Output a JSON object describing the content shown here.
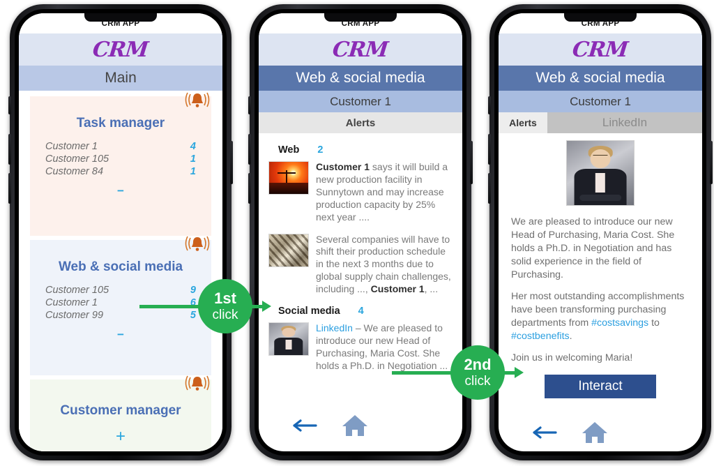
{
  "colors": {
    "brand_purple": "#8b2bb5",
    "accent_blue": "#2ba6de",
    "nav_dark": "#5976ab",
    "nav_light": "#b9c8e6",
    "callout_green": "#27ae52",
    "interact_blue": "#2d4f8e"
  },
  "phone1": {
    "status_title": "CRM APP",
    "brand": "CRM",
    "nav_title": "Main",
    "cards": [
      {
        "title": "Task manager",
        "rows": [
          {
            "name": "Customer 1",
            "value": "4"
          },
          {
            "name": "Customer 105",
            "value": "1"
          },
          {
            "name": "Customer 84",
            "value": "1"
          }
        ],
        "more": "−"
      },
      {
        "title": "Web & social media",
        "rows": [
          {
            "name": "Customer 105",
            "value": "9"
          },
          {
            "name": "Customer 1",
            "value": "6"
          },
          {
            "name": "Customer 99",
            "value": "5"
          }
        ],
        "more": "−"
      },
      {
        "title": "Customer manager",
        "rows": [],
        "more": "+"
      }
    ]
  },
  "phone2": {
    "status_title": "CRM APP",
    "brand": "CRM",
    "nav_title": "Web & social media",
    "sub_title": "Customer 1",
    "section_title": "Alerts",
    "groups": [
      {
        "label": "Web",
        "count": "2",
        "items": [
          {
            "thumb": "sunset-crane-photo",
            "lead": "Customer 1",
            "text": " says it will build a new production facility in Sunnytown and may increase production capacity by 25% next year ...."
          },
          {
            "thumb": "sepia-industry-photo",
            "text_pre": "Several companies will have to shift their production schedule in the next 3 months due to global supply chain challenges, including ..., ",
            "lead": "Customer 1",
            "text_post": ", ..."
          }
        ]
      },
      {
        "label": "Social media",
        "count": "4",
        "items": [
          {
            "thumb": "businesswoman-photo",
            "link": "LinkedIn",
            "text": " – We are pleased to introduce our new Head of Purchasing, Maria Cost. She holds a Ph.D. in Negotiation ..."
          }
        ]
      }
    ],
    "nav": {
      "back": "back-arrow",
      "home": "home"
    }
  },
  "phone3": {
    "status_title": "CRM APP",
    "brand": "CRM",
    "nav_title": "Web & social media",
    "sub_title": "Customer 1",
    "tabs": [
      {
        "label": "Alerts",
        "active": true
      },
      {
        "label": "LinkedIn",
        "active": false
      }
    ],
    "photo": "businesswoman-photo",
    "paragraphs": [
      "We are pleased to introduce our new Head of Purchasing, Maria Cost. She holds a Ph.D. in Negotiation and has solid experience in the field of Purchasing.",
      "Join us in welcoming Maria!"
    ],
    "para2": {
      "pre": "Her most outstanding accomplishments have been transforming purchasing departments from ",
      "tag1": "#costsavings",
      "mid": " to ",
      "tag2": "#costbenefits",
      "post": "."
    },
    "interact_label": "Interact",
    "nav": {
      "back": "back-arrow",
      "home": "home"
    }
  },
  "callouts": [
    {
      "ordinal": "1st",
      "word": "click"
    },
    {
      "ordinal": "2nd",
      "word": "click"
    }
  ]
}
